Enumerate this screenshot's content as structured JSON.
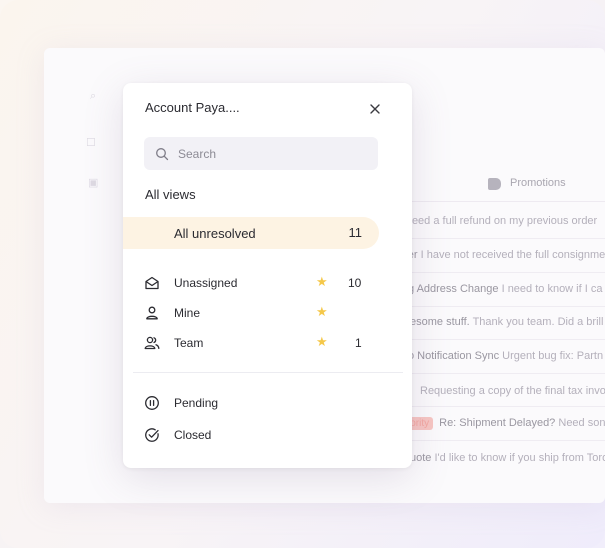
{
  "background": {
    "header": {
      "column_label": "Promotions",
      "tag_icon": "tag-icon"
    },
    "rows": [
      {
        "subject": "",
        "preview": "Need a full refund on my previous order",
        "badge": ""
      },
      {
        "subject": "rder",
        "preview": "I have not received the full consignment",
        "badge": ""
      },
      {
        "subject": "g Address Change",
        "preview": "I need to know if I ca",
        "badge": ""
      },
      {
        "subject": "esome stuff.",
        "preview": "Thank you team. Did a brill",
        "badge": ""
      },
      {
        "subject": "o Notification Sync",
        "preview": "Urgent bug fix: Partn",
        "badge": ""
      },
      {
        "subject": "",
        "preview": "Requesting a copy of the final tax invoi",
        "badge": ""
      },
      {
        "subject": "Re: Shipment Delayed?",
        "preview": "Need son",
        "badge": "iority"
      },
      {
        "subject": "uote",
        "preview": "I'd like to know if you ship from Toro",
        "badge": ""
      }
    ]
  },
  "menu": {
    "title": "Account Paya....",
    "close_icon": "close-icon",
    "search": {
      "placeholder": "Search",
      "icon": "search-icon"
    },
    "section_label": "All views",
    "active_view": {
      "label": "All unresolved",
      "count": "11"
    },
    "views": [
      {
        "label": "Unassigned",
        "icon": "inbox-icon",
        "starred": true,
        "count": "10"
      },
      {
        "label": "Mine",
        "icon": "user-icon",
        "starred": true,
        "count": ""
      },
      {
        "label": "Team",
        "icon": "team-icon",
        "starred": true,
        "count": "1"
      }
    ],
    "statuses": [
      {
        "label": "Pending",
        "icon": "pause-circle-icon"
      },
      {
        "label": "Closed",
        "icon": "check-circle-icon"
      }
    ]
  },
  "colors": {
    "active_row_bg": "#fdf3e3",
    "star": "#f5c84a",
    "badge_bg": "#f7c6c3"
  }
}
